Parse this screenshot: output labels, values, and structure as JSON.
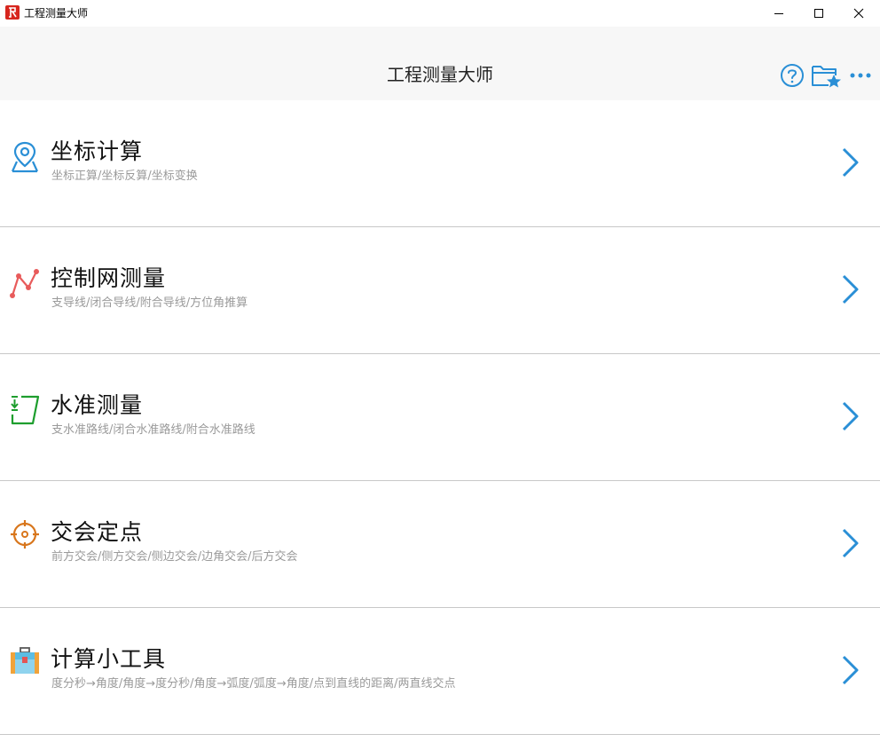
{
  "window": {
    "title": "工程测量大师",
    "controls": [
      "minimize",
      "maximize",
      "close"
    ]
  },
  "header": {
    "title": "工程测量大师",
    "icons": [
      "help-icon",
      "favorites-folder-icon",
      "more-icon"
    ]
  },
  "menu": {
    "items": [
      {
        "title": "坐标计算",
        "subtitle": "坐标正算/坐标反算/坐标变换",
        "icon": "location-pin-icon",
        "icon_color": "#2a8fd6"
      },
      {
        "title": "控制网测量",
        "subtitle": "支导线/闭合导线/附合导线/方位角推算",
        "icon": "traverse-line-icon",
        "icon_color": "#e85b5b"
      },
      {
        "title": "水准测量",
        "subtitle": "支水准路线/闭合水准路线/附合水准路线",
        "icon": "leveling-icon",
        "icon_color": "#1e9e2e"
      },
      {
        "title": "交会定点",
        "subtitle": "前方交会/侧方交会/侧边交会/边角交会/后方交会",
        "icon": "crosshair-icon",
        "icon_color": "#d8761c"
      },
      {
        "title": "计算小工具",
        "subtitle": "度分秒→角度/角度→度分秒/角度→弧度/弧度→角度/点到直线的距离/两直线交点",
        "icon": "toolbox-icon",
        "icon_color": "#4bb6e0"
      }
    ]
  },
  "colors": {
    "accent": "#2a8fd6",
    "header_bg": "#f7f7f7",
    "divider": "#c8c8c8",
    "subtitle": "#9a9a9a"
  }
}
